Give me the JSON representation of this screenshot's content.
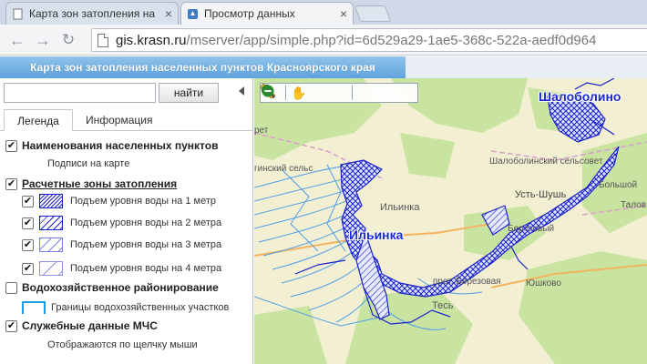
{
  "browser": {
    "tabs": [
      {
        "title": "Карта зон затопления на",
        "active": false
      },
      {
        "title": "Просмотр данных",
        "active": true
      }
    ],
    "url_host": "gis.krasn.ru",
    "url_path": "/mserver/app/simple.php?id=6d529a29-1ae5-368c-522a-aedf0d964"
  },
  "app": {
    "title": "Карта зон затопления населенных пунктов Красноярского края"
  },
  "search": {
    "placeholder": "",
    "button_label": "найти"
  },
  "panel_tabs": {
    "legend": "Легенда",
    "info": "Информация"
  },
  "legend": {
    "groups": [
      {
        "label": "Наименования населенных пунктов",
        "checked": true,
        "items": [
          {
            "label": "Подписи на карте"
          }
        ]
      },
      {
        "label": "Расчетные зоны затопления",
        "checked": true,
        "items": [
          {
            "label": "Подъем уровня воды на 1 метр",
            "checked": true
          },
          {
            "label": "Подъем уровня воды на 2 метра",
            "checked": true
          },
          {
            "label": "Подъем уровня воды на 3 метра",
            "checked": true
          },
          {
            "label": "Подъем уровня воды на 4 метра",
            "checked": true
          }
        ]
      },
      {
        "label": "Водохозяйственное районирование",
        "checked": false,
        "items": [
          {
            "label": "Границы водохозяйственных участков"
          }
        ]
      },
      {
        "label": "Служебные данные МЧС",
        "checked": true,
        "items": [
          {
            "label": "Отображаются по щелчку мыши"
          }
        ]
      }
    ]
  },
  "map": {
    "labels": {
      "shalobolino": "Шалоболино",
      "shalobolino_council": "Шалоболинский сельсовет",
      "ilinka_big": "Ильинка",
      "ilinka_small": "Ильинка",
      "ust_shush": "Усть-Шушь",
      "berezovy": "Березовый",
      "bolshoy": "Большой",
      "talov": "Талов",
      "yushkovo": "Юшково",
      "prot_berezovaya": "прот. Березовая",
      "tes": "Тесь",
      "council_left": "гинский сельс",
      "ret": "рет"
    },
    "colors": {
      "flood": "#1a22cc",
      "rivers": "#4f9fe6",
      "forest": "#c9e3a1",
      "field": "#f2efd2"
    }
  },
  "icons": [
    "page-icon",
    "back-arrow-icon",
    "forward-arrow-icon",
    "reload-icon",
    "collapse-arrow-icon",
    "zoom-extent-icon",
    "pan-hand-icon",
    "identify-icon",
    "ruler-icon",
    "zoom-in-icon",
    "zoom-out-icon"
  ]
}
